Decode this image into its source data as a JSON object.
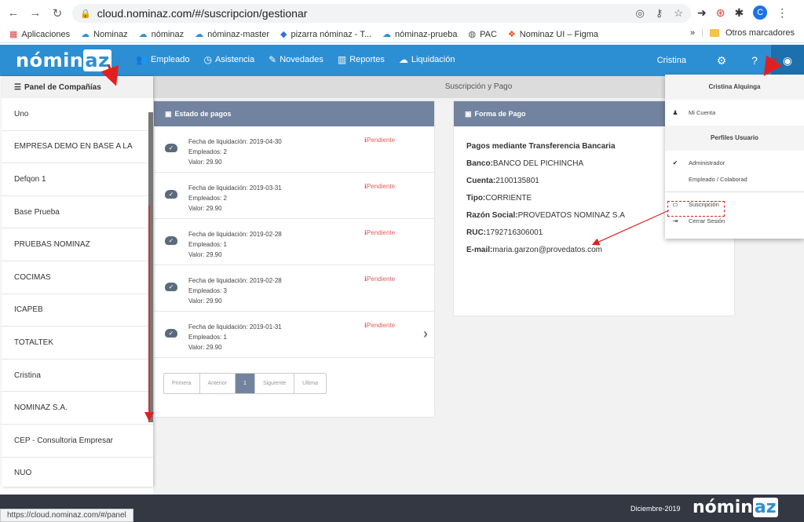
{
  "browser": {
    "url": "cloud.nominaz.com/#/suscripcion/gestionar",
    "profile_initial": "C",
    "status_url": "https://cloud.nominaz.com/#/panel",
    "bookmarks": [
      "Aplicaciones",
      "Nominaz",
      "nóminaz",
      "nóminaz-master",
      "pizarra nóminaz - T...",
      "nóminaz-prueba",
      "PAC",
      "Nominaz UI – Figma"
    ],
    "bookmarks_more": "»",
    "other_bookmarks": "Otros marcadores"
  },
  "nav": {
    "logo": "nómin",
    "logo_az": "az",
    "items": [
      "Empleado",
      "Asistencia",
      "Novedades",
      "Reportes",
      "Liquidación"
    ],
    "user": "Cristina"
  },
  "left_panel": {
    "title": "Panel de Compañías",
    "companies": [
      "Uno",
      "EMPRESA DEMO EN BASE A LA",
      "Defqon 1",
      "Base Prueba",
      "PRUEBAS NOMINAZ",
      "COCIMAS",
      "ICAPEB",
      "TOTALTEK",
      "Cristina",
      "NOMINAZ S.A.",
      "CEP - Consultoria Empresar",
      "NUO"
    ]
  },
  "page": {
    "title": "Suscripción y Pago"
  },
  "payments": {
    "title": "Estado de pagos",
    "rows": [
      {
        "fecha": "Fecha de liquidación: 2019-04-30",
        "empleados": "Empleados: 2",
        "valor": "Valor: 29.90",
        "status": "Pendiente"
      },
      {
        "fecha": "Fecha de liquidación: 2019-03-31",
        "empleados": "Empleados: 2",
        "valor": "Valor: 29.90",
        "status": "Pendiente"
      },
      {
        "fecha": "Fecha de liquidación: 2019-02-28",
        "empleados": "Empleados: 1",
        "valor": "Valor: 29.90",
        "status": "Pendiente"
      },
      {
        "fecha": "Fecha de liquidación: 2019-02-28",
        "empleados": "Empleados: 3",
        "valor": "Valor: 29.90",
        "status": "Pendiente"
      },
      {
        "fecha": "Fecha de liquidación: 2019-01-31",
        "empleados": "Empleados: 1",
        "valor": "Valor: 29.90",
        "status": "Pendiente"
      }
    ],
    "pager": [
      "Primera",
      "Anterior",
      "1",
      "Siguiente",
      "Ultima"
    ]
  },
  "forma_pago": {
    "title": "Forma de Pago",
    "heading": "Pagos mediante Transferencia Bancaria",
    "lines": [
      {
        "label": "Banco:",
        "value": "BANCO DEL PICHINCHA"
      },
      {
        "label": "Cuenta:",
        "value": "2100135801"
      },
      {
        "label": "Tipo:",
        "value": "CORRIENTE"
      },
      {
        "label": "Razón Social:",
        "value": "PROVEDATOS NOMINAZ S.A"
      },
      {
        "label": "RUC:",
        "value": "1792716306001"
      },
      {
        "label": "E-mail:",
        "value": "maria.garzon@provedatos.com"
      }
    ]
  },
  "dropdown": {
    "user_name": "Cristina Alquinga",
    "mi_cuenta": "Mi Cuenta",
    "profiles_title": "Perfiles Usuario",
    "profiles": [
      "Administrador",
      "Empleado / Colaborad"
    ],
    "suscripcion": "Suscripción",
    "logout": "Cerrar Sesión"
  },
  "footer": {
    "date": "Diciembre-2019",
    "logo": "nómin",
    "logo_az": "az"
  },
  "colors": {
    "navbar": "#2d8fd3",
    "panel_header": "#72839f",
    "footer": "#333843",
    "pending": "#e85a5a",
    "annotation": "#e02020"
  }
}
